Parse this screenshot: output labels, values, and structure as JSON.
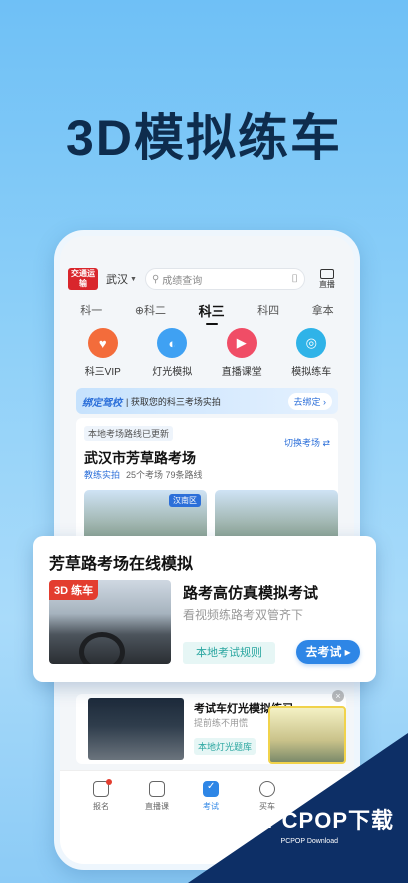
{
  "headline": "3D模拟练车",
  "colors": {
    "accent": "#2e86e6",
    "red": "#d9262c",
    "teal": "#2aa6a0",
    "navy": "#0d2f66"
  },
  "topbar": {
    "logo": "交通运输",
    "city": "武汉",
    "search_placeholder": "成绩查询",
    "live_label": "直播"
  },
  "subject_tabs": [
    "科一",
    "科二",
    "科三",
    "科四",
    "拿本"
  ],
  "subject_active_index": 2,
  "features": [
    {
      "label": "科三VIP",
      "icon": "heart-shield-icon",
      "color": "#f36c3b"
    },
    {
      "label": "灯光模拟",
      "icon": "headlight-icon",
      "color": "#3fa1f3"
    },
    {
      "label": "直播课堂",
      "icon": "tv-icon",
      "color": "#f04d66"
    },
    {
      "label": "模拟练车",
      "icon": "steering-wheel-icon",
      "color": "#2fb3e8"
    }
  ],
  "bind_banner": {
    "tag": "绑定驾校",
    "desc": "| 获取您的科三考场实拍",
    "button": "去绑定 ›"
  },
  "exam_card": {
    "updated": "本地考场路线已更新",
    "switch": "切换考场 ⇄",
    "name": "武汉市芳草路考场",
    "meta_tag": "教练实拍",
    "meta_count": "25个考场  79条路线",
    "area_badge": "汉南区"
  },
  "sim_card": {
    "title": "芳草路考场在线模拟",
    "badge": "3D 练车",
    "heading": "路考高仿真模拟考试",
    "sub": "看视频练路考双管齐下",
    "rule_button": "本地考试规则",
    "go_button": "去考试 ▸"
  },
  "light_card": {
    "title": "考试车灯光模拟练习",
    "desc": "提前练不用慌",
    "lib_button": "本地灯光题库"
  },
  "bottom_nav": [
    {
      "label": "报名",
      "icon": "signup-icon"
    },
    {
      "label": "直播课",
      "icon": "live-class-icon"
    },
    {
      "label": "考试",
      "icon": "exam-icon"
    },
    {
      "label": "买车",
      "icon": "car-icon"
    }
  ],
  "watermark": {
    "brand": "PCPOP下载",
    "sub": "PCPOP Download"
  }
}
